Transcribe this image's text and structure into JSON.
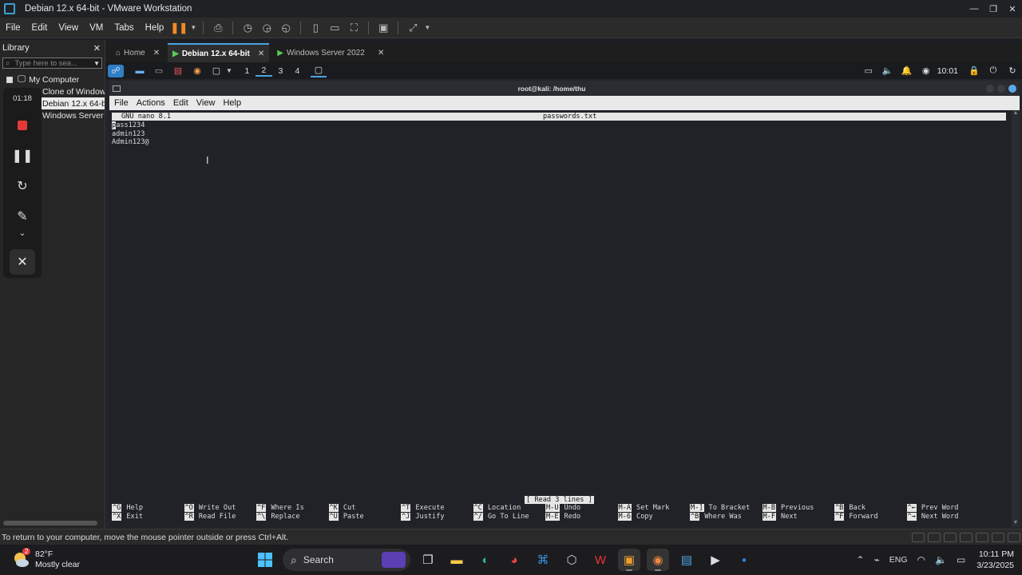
{
  "vmware": {
    "title": "Debian 12.x 64-bit - VMware Workstation",
    "menu": [
      "File",
      "Edit",
      "View",
      "VM",
      "Tabs",
      "Help"
    ],
    "library": {
      "title": "Library",
      "search_placeholder": "Type here to sea...",
      "root": "My Computer",
      "items": [
        "Clone of Window",
        "Debian 12.x 64-b",
        "Windows Server 2"
      ],
      "selected_index": 1
    },
    "side_strip": {
      "timer": "01:18"
    },
    "tabs": [
      {
        "label": "Home",
        "active": false
      },
      {
        "label": "Debian 12.x 64-bit",
        "active": true
      },
      {
        "label": "Windows Server 2022",
        "active": false
      }
    ],
    "status_message": "To return to your computer, move the mouse pointer outside or press Ctrl+Alt."
  },
  "guest": {
    "workspaces": [
      "1",
      "2",
      "3",
      "4"
    ],
    "current_workspace": "2",
    "clock": "10:01",
    "terminal": {
      "title": "root@kali: /home/thu",
      "menu": [
        "File",
        "Actions",
        "Edit",
        "View",
        "Help"
      ],
      "nano": {
        "version": "GNU nano 8.1",
        "filename": "passwords.txt",
        "lines": [
          "pass1234",
          "admin123",
          "Admin123@"
        ],
        "status": "[ Read 3 lines ]",
        "shortcuts": [
          {
            "k1": "^G",
            "l1": "Help",
            "k2": "^X",
            "l2": "Exit"
          },
          {
            "k1": "^O",
            "l1": "Write Out",
            "k2": "^R",
            "l2": "Read File"
          },
          {
            "k1": "^F",
            "l1": "Where Is",
            "k2": "^\\",
            "l2": "Replace"
          },
          {
            "k1": "^K",
            "l1": "Cut",
            "k2": "^U",
            "l2": "Paste"
          },
          {
            "k1": "^T",
            "l1": "Execute",
            "k2": "^J",
            "l2": "Justify"
          },
          {
            "k1": "^C",
            "l1": "Location",
            "k2": "^/",
            "l2": "Go To Line"
          },
          {
            "k1": "M-U",
            "l1": "Undo",
            "k2": "M-E",
            "l2": "Redo"
          },
          {
            "k1": "M-A",
            "l1": "Set Mark",
            "k2": "M-6",
            "l2": "Copy"
          },
          {
            "k1": "M-]",
            "l1": "To Bracket",
            "k2": "^B",
            "l2": "Where Was"
          },
          {
            "k1": "M-B",
            "l1": "Previous",
            "k2": "M-F",
            "l2": "Next"
          },
          {
            "k1": "^B",
            "l1": "Back",
            "k2": "^F",
            "l2": "Forward"
          },
          {
            "k1": "^←",
            "l1": "Prev Word",
            "k2": "^→",
            "l2": "Next Word"
          }
        ]
      }
    }
  },
  "taskbar": {
    "weather": {
      "temp": "82°F",
      "desc": "Mostly clear",
      "badge": "2"
    },
    "search_label": "Search",
    "tray": {
      "lang": "ENG",
      "time": "10:11 PM",
      "date": "3/23/2025"
    }
  },
  "colors": {
    "accent": "#4aa3df",
    "pause": "#f08a24",
    "stop": "#e53939"
  }
}
